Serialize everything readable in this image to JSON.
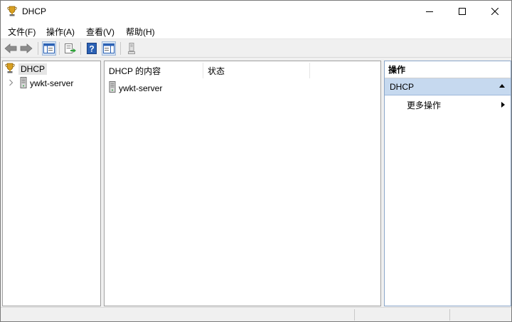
{
  "window": {
    "title": "DHCP"
  },
  "menu": [
    {
      "label": "文件(F)"
    },
    {
      "label": "操作(A)"
    },
    {
      "label": "查看(V)"
    },
    {
      "label": "帮助(H)"
    }
  ],
  "tree": {
    "root": {
      "label": "DHCP",
      "icon": "dhcp-icon"
    },
    "children": [
      {
        "label": "ywkt-server",
        "icon": "server-icon"
      }
    ]
  },
  "content": {
    "columns": [
      {
        "label": "DHCP 的内容"
      },
      {
        "label": "状态"
      }
    ],
    "rows": [
      {
        "name": "ywkt-server",
        "status": ""
      }
    ]
  },
  "actions": {
    "title": "操作",
    "section": "DHCP",
    "items": [
      {
        "label": "更多操作"
      }
    ]
  },
  "colors": {
    "selection_bg": "#e5e5e5",
    "actions_section_bg": "#c6d9ef",
    "toolbar_blue": "#2b61b4"
  }
}
